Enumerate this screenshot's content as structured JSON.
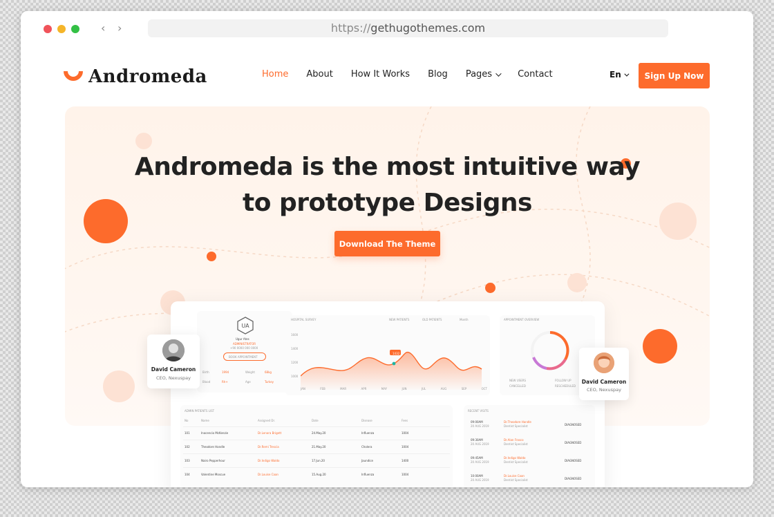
{
  "browser": {
    "url_protocol": "https://",
    "url_host": "gethugothemes.com"
  },
  "header": {
    "logo_text": "Andromeda",
    "nav": [
      {
        "label": "Home",
        "active": true
      },
      {
        "label": "About",
        "active": false
      },
      {
        "label": "How It Works",
        "active": false
      },
      {
        "label": "Blog",
        "active": false
      },
      {
        "label": "Pages",
        "active": false,
        "dropdown": true
      },
      {
        "label": "Contact",
        "active": false
      }
    ],
    "language": "En",
    "signup_label": "Sign Up Now"
  },
  "hero": {
    "headline_line1": "Andromeda is the most intuitive way",
    "headline_line2": "to prototype Designs",
    "cta_label": "Download The Theme"
  },
  "dashboard": {
    "profile_name": "Ugur Ates",
    "profile_sub": "ADMINISTRATOR",
    "profile_phone": "+90 0000 000 0000",
    "book_label": "BOOK APPOINTMENT",
    "stats": [
      {
        "label": "Birth",
        "value": "1994"
      },
      {
        "label": "Weight",
        "value": "68kg"
      },
      {
        "label": "Blood",
        "value": "Rh+"
      },
      {
        "label": "Age",
        "value": "Turkey"
      }
    ],
    "survey_title": "HOSPITAL SURVEY",
    "legend_new": "NEW PATIENTS",
    "legend_old": "OLD PATIENTS",
    "month_label": "Month",
    "peak_label": "1432",
    "y_ticks": [
      "1000",
      "1200",
      "1400",
      "1600"
    ],
    "x_ticks": [
      "JAN",
      "FEB",
      "MAR",
      "APR",
      "MAY",
      "JUN",
      "JUL",
      "AUG",
      "SEP",
      "OCT"
    ],
    "appointment_title": "APPOINTMENT OVERVIEW",
    "appointment_legend": [
      "NEW USERS",
      "CANCELLED",
      "FOLLOW UP",
      "RESCHEDULED"
    ],
    "list_title": "ADMIN PATIENTS LIST",
    "table_headers": [
      "No",
      "Name",
      "Assigned Dr.",
      "Date",
      "Disease",
      "Fees"
    ],
    "patients": [
      {
        "no": "101",
        "name": "Inocencio McKenzie",
        "doctor": "Dr.Lenora Brigett",
        "date": "24.May.20",
        "disease": "Influenza",
        "fee": "1004"
      },
      {
        "no": "102",
        "name": "Theodore Handle",
        "doctor": "Dr.Remi Trescia",
        "date": "21.May.20",
        "disease": "Cholera",
        "fee": "1004"
      },
      {
        "no": "103",
        "name": "Nairo Pepperhour",
        "doctor": "Dr.Indigo Waldo",
        "date": "17.Jun.20",
        "disease": "Jaundice",
        "fee": "1400"
      },
      {
        "no": "104",
        "name": "Valentine Moscue",
        "doctor": "Dr.Louise Caan",
        "date": "15.Aug.20",
        "disease": "Influenza",
        "fee": "1004"
      }
    ],
    "recent_title": "RECENT VISITS",
    "visits": [
      {
        "time": "09:00AM",
        "date": "20 AUG 2019",
        "doctor": "Dr.Theodore Handle",
        "role": "Dentist Specialist",
        "tag": "DIAGNOSED"
      },
      {
        "time": "09:30AM",
        "date": "20 AUG 2019",
        "doctor": "Dr.Alan Frasco",
        "role": "Dentist Specialist",
        "tag": "DIAGNOSED"
      },
      {
        "time": "09:45AM",
        "date": "20 AUG 2019",
        "doctor": "Dr.Indigo Waldo",
        "role": "Dentist Specialist",
        "tag": "DIAGNOSED"
      },
      {
        "time": "10:00AM",
        "date": "20 AUG 2019",
        "doctor": "Dr.Louise Caan",
        "role": "Dentist Specialist",
        "tag": "DIAGNOSED"
      }
    ]
  },
  "cards": [
    {
      "name": "David Cameron",
      "role": "CEO, Nexuspay"
    },
    {
      "name": "David Cameron",
      "role": "CEO, Nexuspay"
    }
  ],
  "colors": {
    "accent": "#fd6b2c",
    "hero_bg": "#fff3ea",
    "text_dark": "#222222"
  }
}
